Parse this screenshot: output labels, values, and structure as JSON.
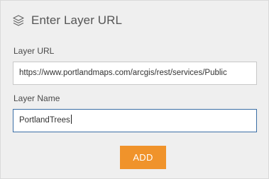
{
  "header": {
    "icon": "layers-icon",
    "title": "Enter Layer URL"
  },
  "layer_url": {
    "label": "Layer URL",
    "value": "https://www.portlandmaps.com/arcgis/rest/services/Public"
  },
  "layer_name": {
    "label": "Layer Name",
    "value": "PortlandTrees"
  },
  "actions": {
    "add_label": "ADD",
    "accent_color": "#f0932b"
  }
}
